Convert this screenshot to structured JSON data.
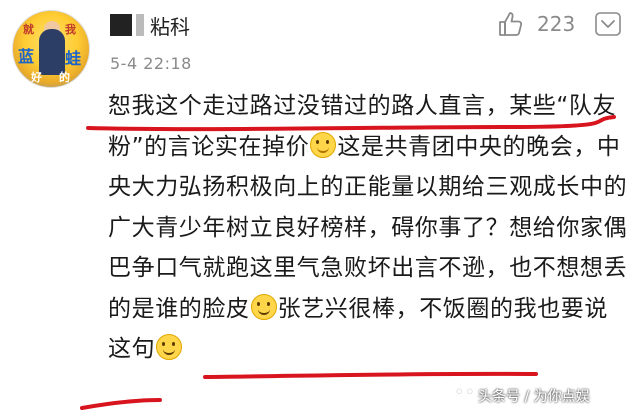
{
  "user": {
    "avatar_text": [
      "就",
      "我",
      "蓝",
      "蛙",
      "好",
      "的"
    ],
    "name": "粘科",
    "timestamp": "5-4 22:18"
  },
  "actions": {
    "like_count": "223"
  },
  "comment": {
    "segments": [
      "恕我这个走过路过没错过的路人直言，某些“队友粉”的言论实在掉价",
      "这是共青团中央的晚会，中央大力弘扬积极向上的正能量以期给三观成长中的广大青少年树立良好榜样，碍你事了？想给你家偶巴争口气就跑这里气急败坏出言不逊，也不想想丢的是谁的脸皮",
      "张艺兴很棒，不饭圈的我也要说这句"
    ]
  },
  "annotations": {
    "color": "#d8141e"
  },
  "watermark": {
    "text": "头条号 / 为你点娱"
  }
}
